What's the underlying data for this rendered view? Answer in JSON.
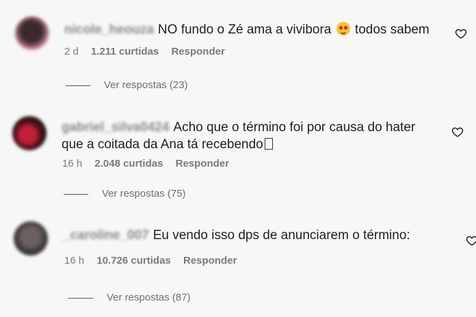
{
  "comments": [
    {
      "username": "nicole_heouza",
      "text_before": "NO fundo o Zé ama a vivibora",
      "emoji": "smiling-face-with-hearts",
      "text_after": "todos sabem",
      "time": "2 d",
      "likes": "1.211 curtidas",
      "reply": "Responder",
      "replies": "Ver respostas (23)"
    },
    {
      "username": "gabriel_silva0424",
      "text_line1": "Acho que o término foi por causa do hater",
      "text_line2": "que a coitada da Ana tá recebendo",
      "time": "16 h",
      "likes": "2.048 curtidas",
      "reply": "Responder",
      "replies": "Ver respostas (75)"
    },
    {
      "username": "_caroline_007",
      "text": "Eu vendo isso dps de anunciarem o término:",
      "time": "16 h",
      "likes": "10.726 curtidas",
      "reply": "Responder",
      "replies": "Ver respostas (87)"
    }
  ],
  "icons": {
    "like": "heart-outline-icon"
  },
  "colors": {
    "background": "#f7f7f7",
    "meta": "#7a7a7a",
    "text": "#202020"
  }
}
